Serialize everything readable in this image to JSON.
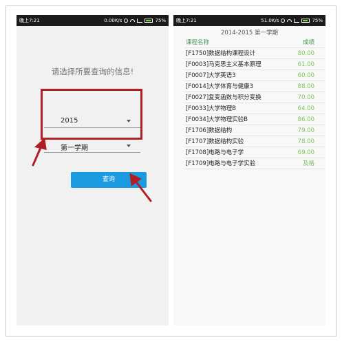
{
  "left": {
    "status": {
      "time": "晚上7:21",
      "speed": "0.00K/s",
      "battery": "75%"
    },
    "prompt": "请选择所要查询的信息!",
    "year_select": {
      "value": "2015"
    },
    "term_select": {
      "value": "第一学期"
    },
    "query_button": "查询"
  },
  "right": {
    "status": {
      "time": "晚上7:21",
      "speed": "51.0K/s",
      "battery": "75%"
    },
    "title": "2014-2015 第一学期",
    "headers": {
      "name": "课程名称",
      "score": "成绩"
    },
    "rows": [
      {
        "name": "[F1750]数据结构课程设计",
        "score": "80.00"
      },
      {
        "name": "[F0003]马克思主义基本原理",
        "score": "61.00"
      },
      {
        "name": "[F0007]大学英语3",
        "score": "60.00"
      },
      {
        "name": "[F0014]大学体育与健康3",
        "score": "88.00"
      },
      {
        "name": "[F0027]复变函数与积分变换",
        "score": "70.00"
      },
      {
        "name": "[F0033]大学物理B",
        "score": "64.00"
      },
      {
        "name": "[F0034]大学物理实验B",
        "score": "86.00"
      },
      {
        "name": "[F1706]数据结构",
        "score": "79.00"
      },
      {
        "name": "[F1707]数据结构实验",
        "score": "78.00"
      },
      {
        "name": "[F1708]电路与电子学",
        "score": "69.00"
      },
      {
        "name": "[F1709]电路与电子学实验",
        "score": "及格"
      }
    ]
  },
  "colors": {
    "accent": "#1a9ae1",
    "highlight": "#b01f23",
    "score": "#7cc35a",
    "statusbar": "#1b1b1b"
  }
}
